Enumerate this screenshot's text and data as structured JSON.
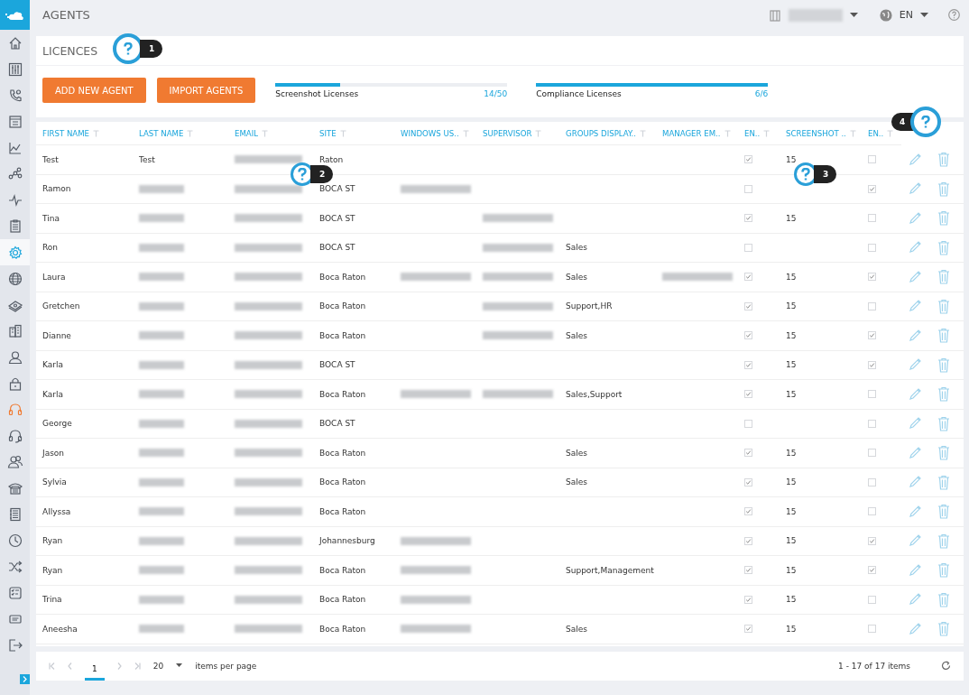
{
  "topbar": {
    "title": "AGENTS",
    "language": "EN"
  },
  "sidebar": {
    "items": [
      {
        "selected": false,
        "alert": false
      },
      {
        "selected": false,
        "alert": false
      },
      {
        "selected": false,
        "alert": false
      },
      {
        "selected": false,
        "alert": false
      },
      {
        "selected": false,
        "alert": false
      },
      {
        "selected": false,
        "alert": false
      },
      {
        "selected": false,
        "alert": false
      },
      {
        "selected": false,
        "alert": false
      },
      {
        "selected": true,
        "alert": false
      },
      {
        "selected": false,
        "alert": false
      },
      {
        "selected": false,
        "alert": false
      },
      {
        "selected": false,
        "alert": false
      },
      {
        "selected": false,
        "alert": false
      },
      {
        "selected": false,
        "alert": false
      },
      {
        "selected": false,
        "alert": true
      },
      {
        "selected": false,
        "alert": false
      },
      {
        "selected": false,
        "alert": false
      },
      {
        "selected": false,
        "alert": false
      },
      {
        "selected": false,
        "alert": false
      },
      {
        "selected": false,
        "alert": false
      },
      {
        "selected": false,
        "alert": false
      },
      {
        "selected": false,
        "alert": false
      },
      {
        "selected": false,
        "alert": false
      },
      {
        "selected": false,
        "alert": false
      }
    ]
  },
  "licences": {
    "title": "LICENCES",
    "buttons": [
      "ADD NEW AGENT",
      "IMPORT AGENTS"
    ],
    "meters": [
      {
        "label": "Screenshot Licenses",
        "reading": "14/50",
        "level": 0.28
      },
      {
        "label": "Compliance Licenses",
        "reading": "6/6",
        "level": 1
      }
    ]
  },
  "table": {
    "columns": [
      "FIRST NAME",
      "LAST NAME",
      "EMAIL",
      "SITE",
      "WINDOWS US..",
      "SUPERVISOR",
      "GROUPS DISPLAY..",
      "MANAGER EM..",
      "EN..",
      "SCREENSHOT ..",
      "EN.."
    ],
    "rows": [
      {
        "first_name": "Test",
        "last_name": "Test",
        "site": "Raton",
        "windows_user": false,
        "supervisor": false,
        "manager": false,
        "en_1": true,
        "screenshot": "15",
        "en_2": false
      },
      {
        "first_name": "Ramon",
        "site": "BOCA ST",
        "windows_user": true,
        "supervisor": false,
        "manager": false,
        "en_1": false,
        "en_2": true
      },
      {
        "first_name": "Tina",
        "site": "BOCA ST",
        "windows_user": false,
        "supervisor": true,
        "manager": false,
        "en_1": true,
        "screenshot": "15",
        "en_2": false
      },
      {
        "first_name": "Ron",
        "site": "BOCA ST",
        "windows_user": false,
        "supervisor": true,
        "groups": "Sales",
        "manager": false,
        "en_1": false,
        "en_2": false
      },
      {
        "first_name": "Laura",
        "site": "Boca Raton",
        "windows_user": true,
        "supervisor": true,
        "groups": "Sales",
        "manager": true,
        "en_1": true,
        "screenshot": "15",
        "en_2": true
      },
      {
        "first_name": "Gretchen",
        "site": "Boca Raton",
        "windows_user": false,
        "supervisor": true,
        "groups": "Support,HR",
        "manager": false,
        "en_1": true,
        "screenshot": "15",
        "en_2": false
      },
      {
        "first_name": "Dianne",
        "site": "Boca Raton",
        "windows_user": false,
        "supervisor": true,
        "groups": "Sales",
        "manager": false,
        "en_1": true,
        "screenshot": "15",
        "en_2": true
      },
      {
        "first_name": "Karla",
        "site": "BOCA ST",
        "windows_user": false,
        "supervisor": false,
        "manager": false,
        "en_1": true,
        "screenshot": "15",
        "en_2": true
      },
      {
        "first_name": "Karla",
        "site": "Boca Raton",
        "windows_user": true,
        "supervisor": true,
        "groups": "Sales,Support",
        "manager": false,
        "en_1": true,
        "screenshot": "15",
        "en_2": false
      },
      {
        "first_name": "George",
        "site": "BOCA ST",
        "windows_user": false,
        "supervisor": false,
        "manager": false,
        "en_1": false,
        "en_2": false
      },
      {
        "first_name": "Jason",
        "site": "Boca Raton",
        "windows_user": false,
        "supervisor": false,
        "groups": "Sales",
        "manager": false,
        "en_1": true,
        "screenshot": "15",
        "en_2": false
      },
      {
        "first_name": "Sylvia",
        "site": "Boca Raton",
        "windows_user": false,
        "supervisor": false,
        "groups": "Sales",
        "manager": false,
        "en_1": true,
        "screenshot": "15",
        "en_2": false
      },
      {
        "first_name": "Allyssa",
        "site": "Boca Raton",
        "windows_user": false,
        "supervisor": false,
        "manager": false,
        "en_1": true,
        "screenshot": "15",
        "en_2": false
      },
      {
        "first_name": "Ryan",
        "site": "Johannesburg",
        "windows_user": true,
        "supervisor": false,
        "manager": false,
        "en_1": true,
        "screenshot": "15",
        "en_2": true
      },
      {
        "first_name": "Ryan",
        "site": "Boca Raton",
        "windows_user": true,
        "supervisor": false,
        "groups": "Support,Management",
        "manager": false,
        "en_1": true,
        "screenshot": "15",
        "en_2": true
      },
      {
        "first_name": "Trina",
        "site": "Boca Raton",
        "windows_user": true,
        "supervisor": false,
        "manager": false,
        "en_1": true,
        "screenshot": "15",
        "en_2": false
      },
      {
        "first_name": "Aneesha",
        "site": "Boca Raton",
        "windows_user": true,
        "supervisor": false,
        "groups": "Sales",
        "manager": false,
        "en_1": true,
        "screenshot": "15",
        "en_2": false
      }
    ]
  },
  "pager": {
    "page": "1",
    "page_size": "20",
    "page_size_label": "items per page",
    "summary": "1 - 17 of 17 items"
  },
  "help_markers": [
    {
      "number": "1"
    },
    {
      "number": "2"
    },
    {
      "number": "3"
    },
    {
      "number": "4"
    }
  ]
}
